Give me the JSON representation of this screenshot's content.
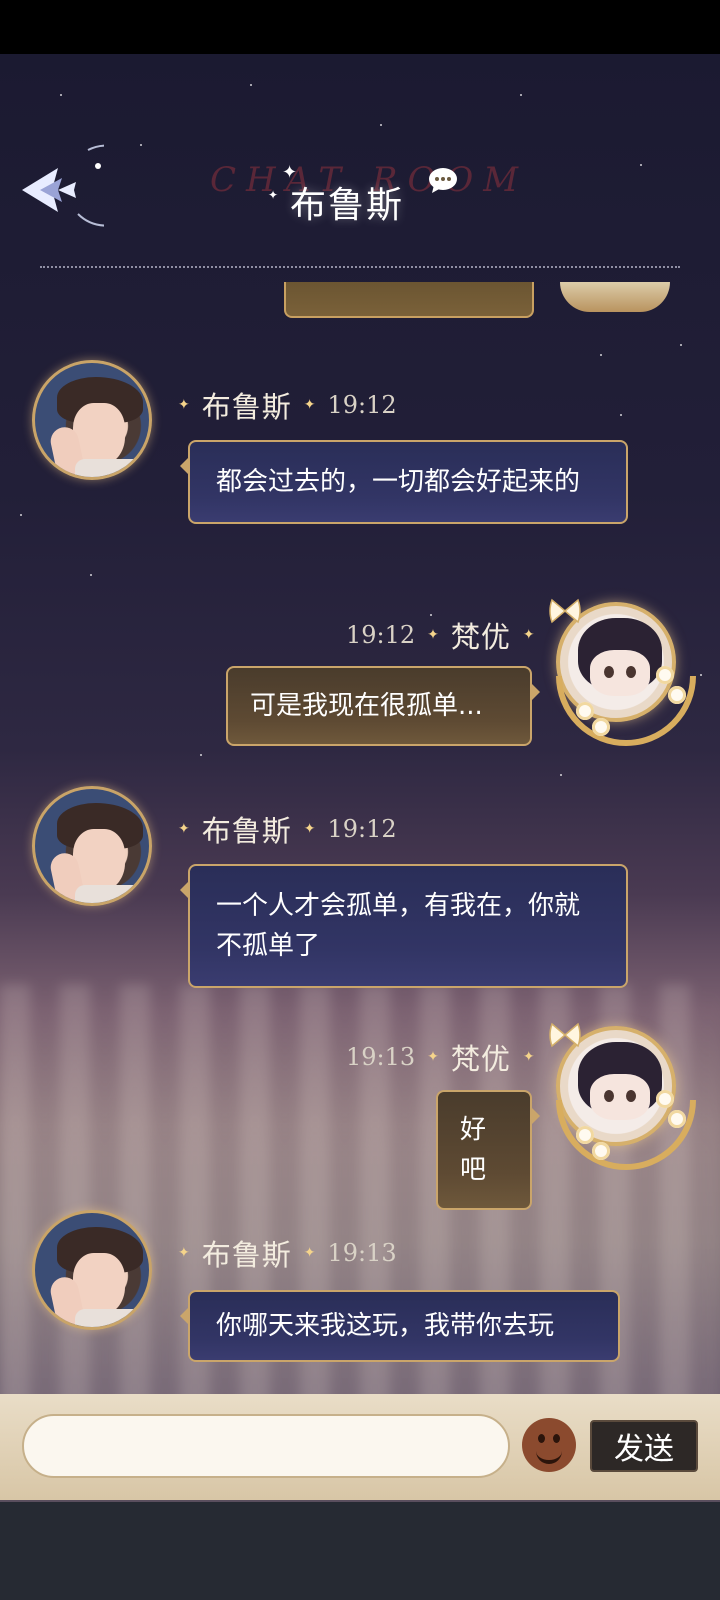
{
  "header": {
    "title": "布鲁斯",
    "decor_text": "CHAT ROOM",
    "back_icon": "back-arrow-icon"
  },
  "messages": [
    {
      "sender": "布鲁斯",
      "time": "19:12",
      "text": "都会过去的，一切都会好起来的",
      "side": "left"
    },
    {
      "sender": "梵优",
      "time": "19:12",
      "text": "可是我现在很孤单...",
      "side": "right"
    },
    {
      "sender": "布鲁斯",
      "time": "19:12",
      "text": "一个人才会孤单，有我在，你就不孤单了",
      "side": "left"
    },
    {
      "sender": "梵优",
      "time": "19:13",
      "text": "好吧",
      "side": "right"
    },
    {
      "sender": "布鲁斯",
      "time": "19:13",
      "text": "你哪天来我这玩，我带你去玩",
      "side": "left"
    }
  ],
  "input": {
    "value": "",
    "placeholder": "",
    "emoji_icon": "smiley-face-icon",
    "send_label": "发送"
  },
  "colors": {
    "bubble_border": "#caa56a",
    "bubble_left": "#2f3260",
    "bubble_right": "#5a4731",
    "input_bar": "#e3d5bb"
  }
}
